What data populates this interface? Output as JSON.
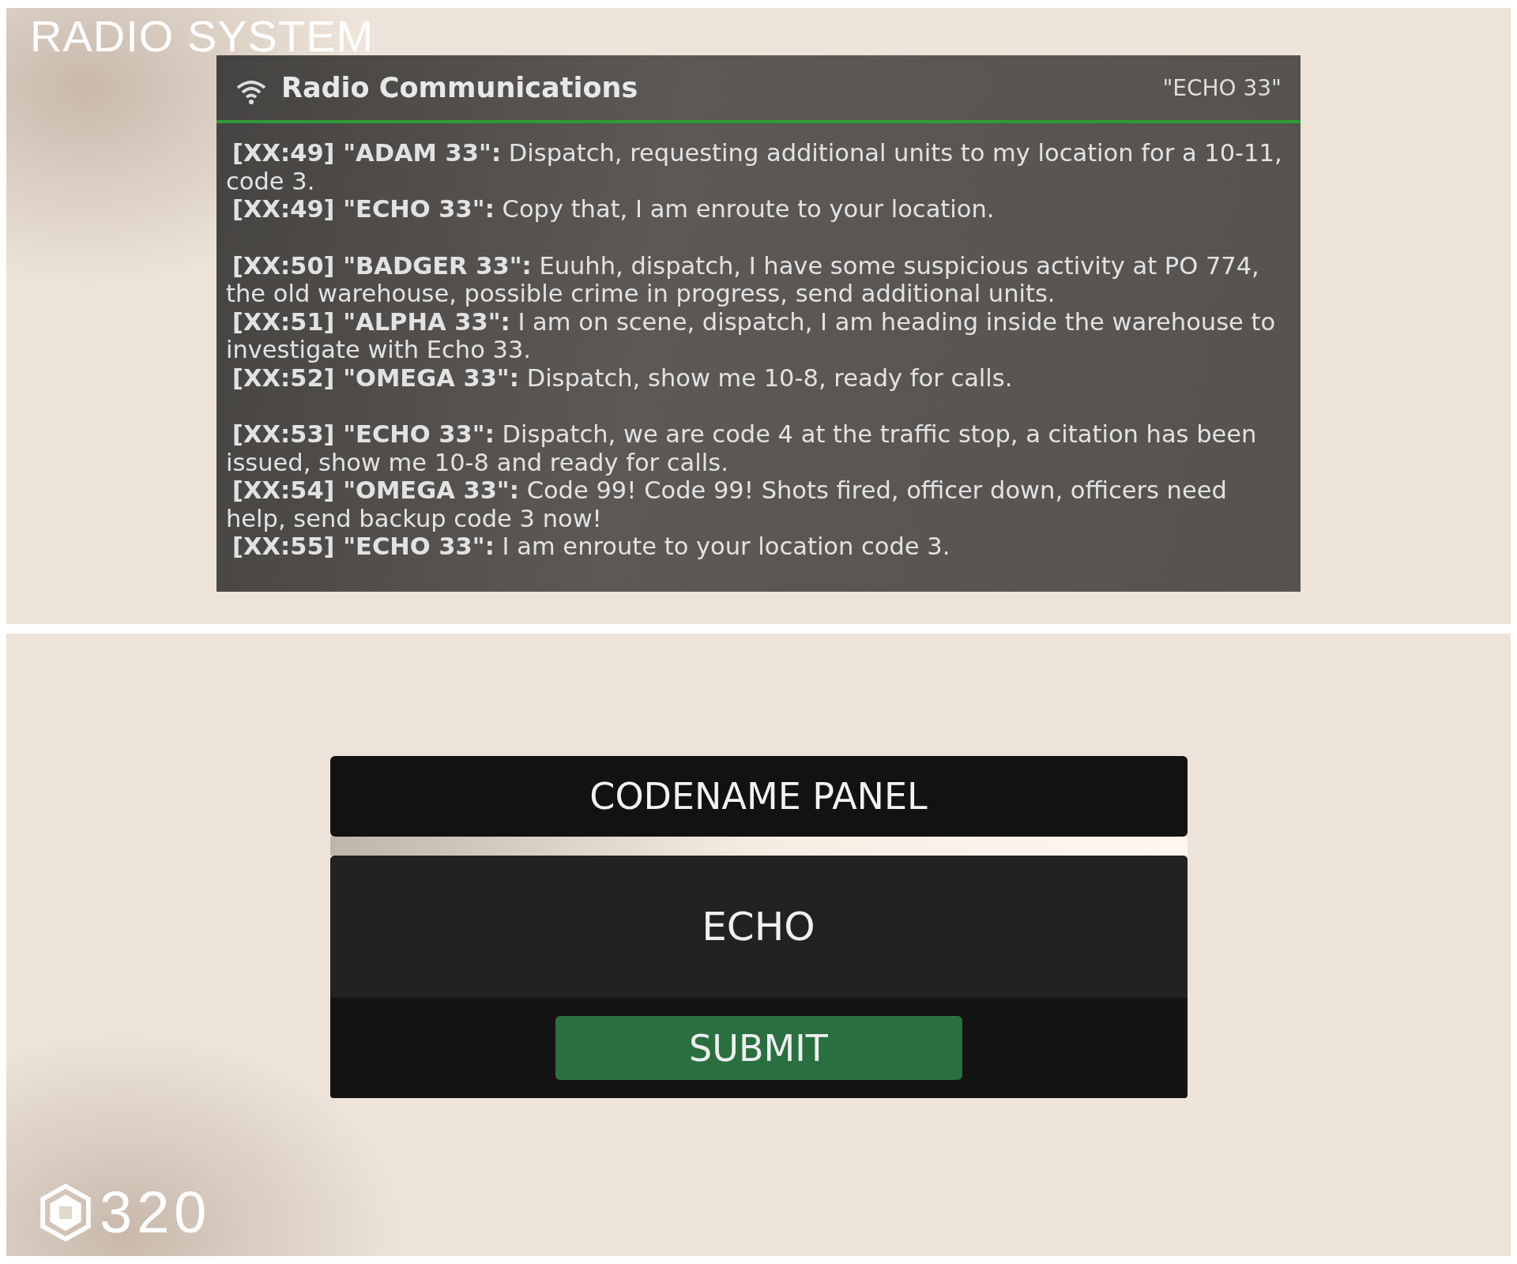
{
  "product_title": "RADIO SYSTEM",
  "radio_window": {
    "title": "Radio Communications",
    "callsign": "\"ECHO 33\"",
    "message_groups": [
      [
        "**[XX:49] \"ADAM 33\":** Dispatch, requesting additional units to my location for a 10-11, code 3.",
        "**[XX:49] \"ECHO 33\":** Copy that, I am enroute to your location."
      ],
      [
        "**[XX:50] \"BADGER 33\":** Euuhh, dispatch, I have some suspicious activity at PO 774, the old warehouse, possible crime in progress, send additional units.",
        "**[XX:51] \"ALPHA 33\":** I am on scene, dispatch, I am heading inside the warehouse to investigate with Echo 33.",
        "**[XX:52] \"OMEGA 33\":** Dispatch, show me 10-8, ready for calls."
      ],
      [
        "**[XX:53] \"ECHO 33\":** Dispatch, we are code 4 at the traffic stop, a citation has been issued, show me 10-8 and ready for calls.",
        "**[XX:54] \"OMEGA 33\":** Code 99! Code 99! Shots fired, officer down, officers need help, send backup code 3 now!",
        "**[XX:55] \"ECHO 33\":** I am enroute to your location code 3."
      ]
    ]
  },
  "codename_panel": {
    "title": "CODENAME PANEL",
    "value": "ECHO",
    "submit": "SUBMIT"
  },
  "price": "320"
}
